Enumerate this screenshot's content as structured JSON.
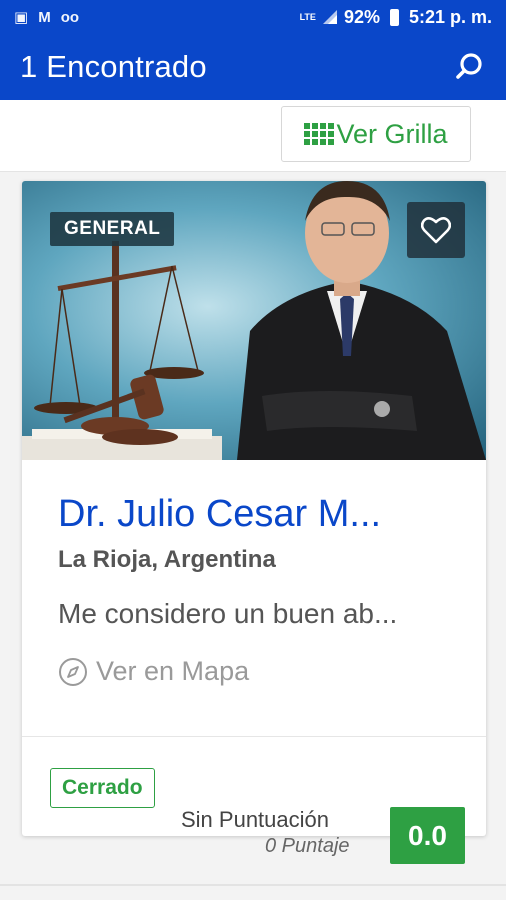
{
  "status_bar": {
    "time": "5:21 p. m.",
    "battery": "92%",
    "network": "LTE",
    "icons": [
      "image-icon",
      "gmail-icon",
      "voicemail-icon"
    ]
  },
  "app_bar": {
    "title": "1 Encontrado",
    "search_icon": "search-icon"
  },
  "toolbar": {
    "grid_button_label": "Ver Grilla",
    "grid_icon": "grid-icon"
  },
  "listing": {
    "category": "GENERAL",
    "title": "Dr. Julio Cesar M...",
    "location": "La Rioja, Argentina",
    "description": "Me considero un buen ab...",
    "map_link": "Ver en Mapa",
    "status": "Cerrado",
    "rating_label": "Sin Puntuación",
    "rating_count": "0 Puntaje",
    "score": "0.0"
  },
  "colors": {
    "primary": "#0a47c9",
    "accent_green": "#2ea043"
  }
}
